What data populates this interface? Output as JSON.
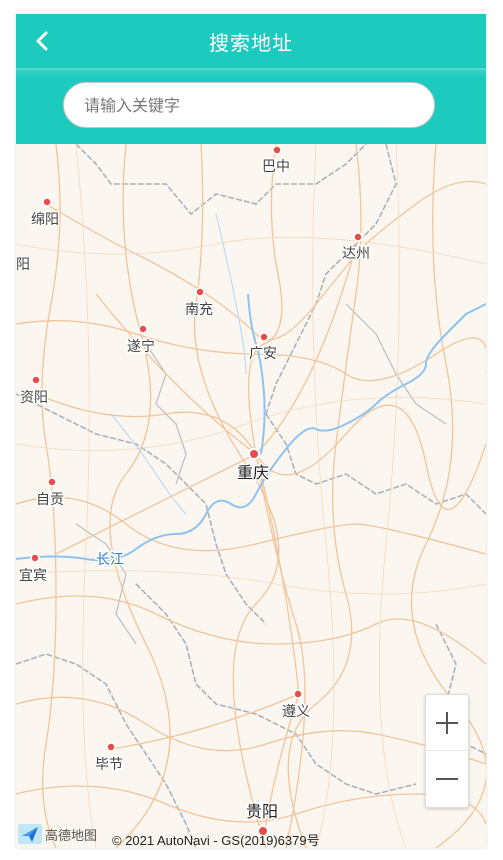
{
  "header": {
    "title": "搜索地址",
    "back_icon": "chevron-left-icon"
  },
  "search": {
    "placeholder": "请输入关键字",
    "value": ""
  },
  "map": {
    "cities": {
      "bazhong": "巴中",
      "mianyang": "绵阳",
      "dazhou": "达州",
      "nanchong": "南充",
      "suining": "遂宁",
      "guangan": "广安",
      "ziyang": "资阳",
      "chongqing": "重庆",
      "zigong": "自贡",
      "yibin": "宜宾",
      "zunyi": "遵义",
      "bijie": "毕节",
      "guiyang": "贵阳",
      "edge_left": "阳"
    },
    "river": "长江"
  },
  "zoom": {
    "in_icon": "plus-icon",
    "out_icon": "minus-icon"
  },
  "attribution": {
    "logo_text": "高德地图",
    "copyright": "© 2021 AutoNavi - GS(2019)6379号"
  },
  "colors": {
    "accent": "#1ccbbd",
    "road": "#f2c49c",
    "river": "#8ec3f0",
    "border": "#a9b3bd",
    "city_dot": "#e94b4b"
  }
}
